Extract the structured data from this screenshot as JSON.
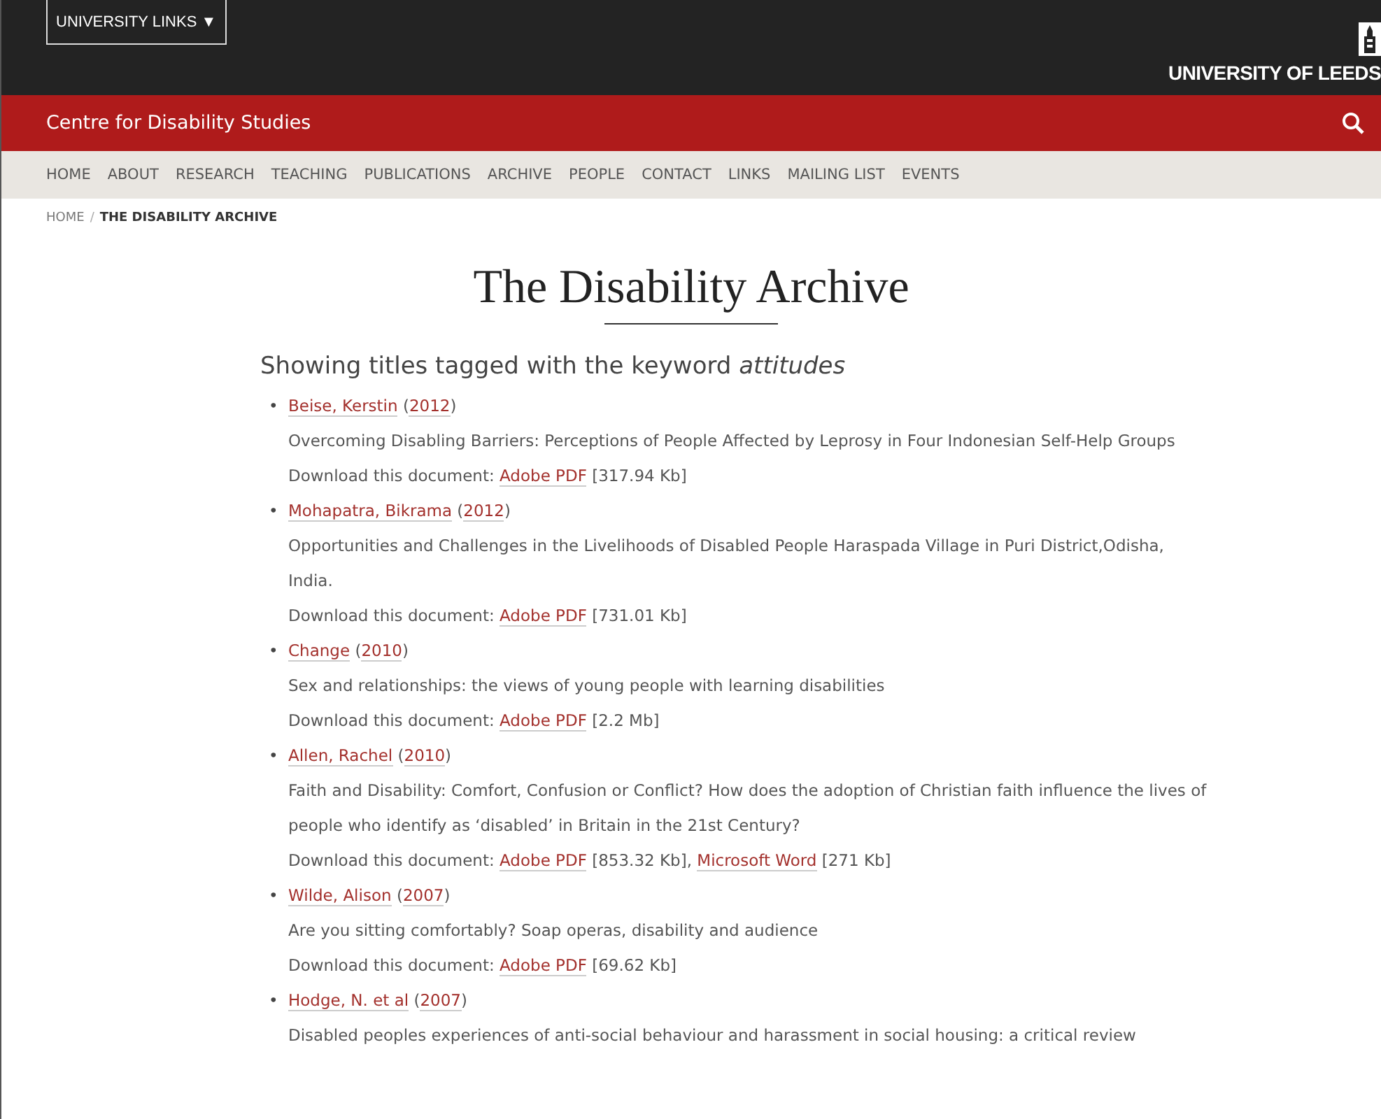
{
  "top_bar": {
    "links_button": "UNIVERSITY LINKS ▼",
    "logo_text": "UNIVERSITY OF LEEDS"
  },
  "site_bar": {
    "title": "Centre for Disability Studies"
  },
  "nav": [
    "HOME",
    "ABOUT",
    "RESEARCH",
    "TEACHING",
    "PUBLICATIONS",
    "ARCHIVE",
    "PEOPLE",
    "CONTACT",
    "LINKS",
    "MAILING LIST",
    "EVENTS"
  ],
  "breadcrumb": {
    "home": "HOME",
    "separator": "/",
    "current": "THE DISABILITY ARCHIVE"
  },
  "page_title": "The Disability Archive",
  "intro": "Showing titles tagged with the keyword *attitudes*",
  "entries": [
    {
      "bullet": "•",
      "author": "Beise, Kerstin",
      "open_paren": "(",
      "year": "2012",
      "close_paren": ")",
      "title": "Overcoming Disabling Barriers: Perceptions of People Affected by Leprosy in Four Indonesian Self-Help Groups",
      "download_label": "Download this document:",
      "files": [
        {
          "format": "Adobe PDF",
          "size": "[317.94 Kb]"
        }
      ]
    },
    {
      "bullet": "•",
      "author": "Mohapatra, Bikrama",
      "open_paren": "(",
      "year": "2012",
      "close_paren": ")",
      "title": "Opportunities and Challenges in the Livelihoods of Disabled People Haraspada Village in Puri District,Odisha, India.",
      "download_label": "Download this document:",
      "files": [
        {
          "format": "Adobe PDF",
          "size": "[731.01 Kb]"
        }
      ]
    },
    {
      "bullet": "•",
      "author": "Change",
      "open_paren": "(",
      "year": "2010",
      "close_paren": ")",
      "title": "Sex and relationships: the views of young people with learning disabilities",
      "download_label": "Download this document:",
      "files": [
        {
          "format": "Adobe PDF",
          "size": "[2.2 Mb]"
        }
      ]
    },
    {
      "bullet": "•",
      "author": "Allen, Rachel",
      "open_paren": "(",
      "year": "2010",
      "close_paren": ")",
      "title": "Faith and Disability: Comfort, Confusion or Conflict? How does the adoption of Christian faith influence the lives of people who identify as ‘disabled’ in Britain in the 21st Century?",
      "download_label": "Download this document:",
      "files": [
        {
          "format": "Adobe PDF",
          "size": "[853.32 Kb],"
        },
        {
          "format": "Microsoft Word",
          "size": "[271 Kb]"
        }
      ]
    },
    {
      "bullet": "•",
      "author": "Wilde, Alison",
      "open_paren": "(",
      "year": "2007",
      "close_paren": ")",
      "title": "Are you sitting comfortably? Soap operas, disability and audience",
      "download_label": "Download this document:",
      "files": [
        {
          "format": "Adobe PDF",
          "size": "[69.62 Kb]"
        }
      ]
    },
    {
      "bullet": "•",
      "author": "Hodge, N. et al",
      "open_paren": "(",
      "year": "2007",
      "close_paren": ")",
      "title": "Disabled peoples experiences of anti-social behaviour and harassment in social housing: a critical review"
    }
  ]
}
